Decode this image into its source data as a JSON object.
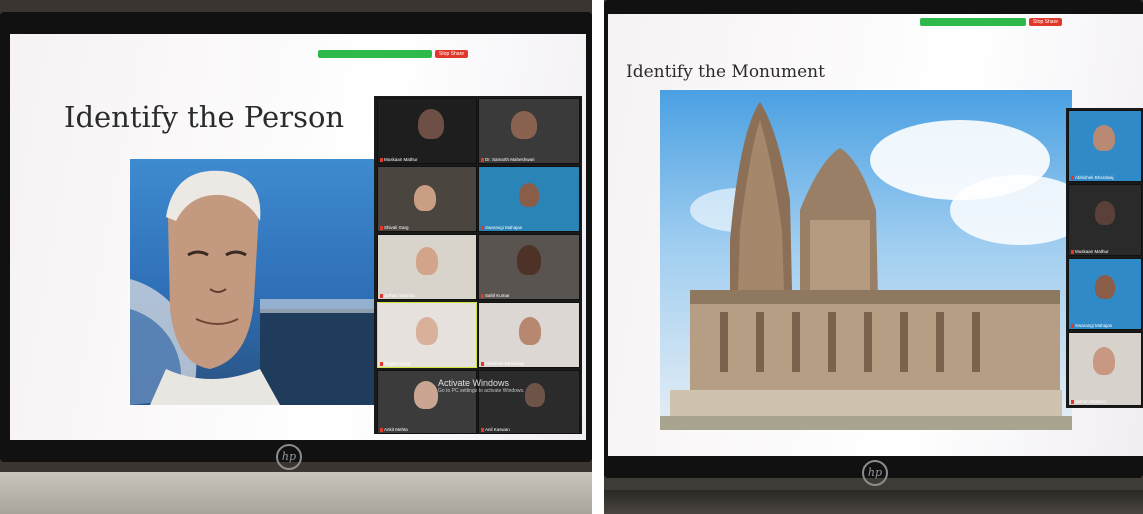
{
  "left_photo": {
    "slide_title": "Identify the Person",
    "brand_logo": "hp",
    "share_button": "Stop Share",
    "watermark": {
      "title": "Activate Windows",
      "subtitle": "Go to PC settings to activate Windows."
    },
    "participants": [
      "Muskaan Mathur",
      "Dr. Samarth Maheshwari",
      "Shivali Garg",
      "Swarangi Mahajan",
      "Jarhan Sharma",
      "Sahil Kumar",
      "Ruyaa Gupta",
      "Abhishek Bhardwaj",
      "Ankit Mehta",
      "Anil Kaswan"
    ]
  },
  "right_photo": {
    "slide_title": "Identify the Monument",
    "brand_logo": "hp",
    "share_button": "Stop Share",
    "participants": [
      "Abhishek Bhardwaj",
      "Muskaan Mathur",
      "Swarangi Mahajan",
      "Jarhan Sharma"
    ]
  }
}
